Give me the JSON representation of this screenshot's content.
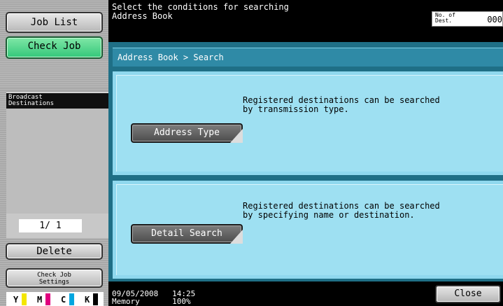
{
  "sidebar": {
    "job_list": "Job List",
    "check_job": "Check Job",
    "broadcast_destinations": "Broadcast\nDestinations",
    "page_counter": "1/ 1",
    "delete": "Delete",
    "check_job_settings": "Check Job\nSettings",
    "toner": [
      {
        "label": "Y",
        "color": "#f4e600"
      },
      {
        "label": "M",
        "color": "#e0007f"
      },
      {
        "label": "C",
        "color": "#00a6e0"
      },
      {
        "label": "K",
        "color": "#000000"
      }
    ]
  },
  "header": {
    "message": "Select the conditions for searching\nAddress Book",
    "dest_label": "No. of\nDest.",
    "dest_count": "000"
  },
  "main": {
    "breadcrumb": "Address Book > Search",
    "sections": [
      {
        "description": "Registered destinations can be searched\nby transmission type.",
        "button": "Address Type"
      },
      {
        "description": "Registered destinations can be searched\nby specifying name or destination.",
        "button": "Detail Search"
      }
    ]
  },
  "footer": {
    "datetime": "09/05/2008   14:25\nMemory       100%",
    "close": "Close"
  },
  "colors": {
    "panel": "#1f6f86",
    "section": "#9ee0f2",
    "check_job": "#34c77a"
  }
}
